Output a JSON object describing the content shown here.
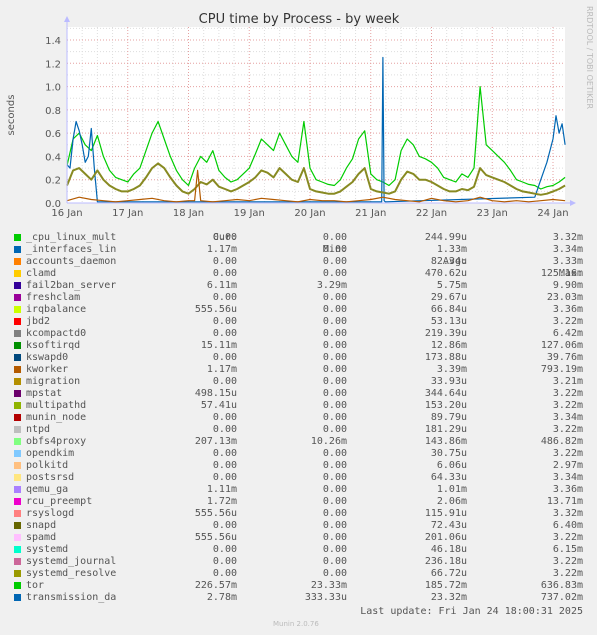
{
  "chart_data": {
    "type": "line",
    "title": "CPU time by Process - by week",
    "xlabel": "",
    "ylabel": "seconds",
    "ylim": [
      0,
      1.5
    ],
    "yticks": [
      "0.0",
      "0.2",
      "0.4",
      "0.6",
      "0.8",
      "1.0",
      "1.2",
      "1.4"
    ],
    "ytick_values": [
      0,
      0.2,
      0.4,
      0.6,
      0.8,
      1.0,
      1.2,
      1.4
    ],
    "xlim_days": [
      0,
      8.2
    ],
    "xticks": [
      "16 Jan",
      "17 Jan",
      "18 Jan",
      "19 Jan",
      "20 Jan",
      "21 Jan",
      "22 Jan",
      "23 Jan",
      "24 Jan"
    ],
    "grid": true,
    "watermark": "RRDTOOL / TOBI OETIKER",
    "series": [
      {
        "name": "tor",
        "color": "#00cc00",
        "x_days": [
          0,
          0.1,
          0.2,
          0.3,
          0.4,
          0.5,
          0.6,
          0.7,
          0.8,
          0.9,
          1.0,
          1.1,
          1.2,
          1.3,
          1.4,
          1.5,
          1.6,
          1.7,
          1.8,
          1.9,
          2.0,
          2.1,
          2.2,
          2.3,
          2.4,
          2.5,
          2.6,
          2.7,
          2.8,
          2.9,
          3.0,
          3.1,
          3.2,
          3.3,
          3.4,
          3.5,
          3.6,
          3.7,
          3.8,
          3.9,
          4.0,
          4.1,
          4.2,
          4.3,
          4.4,
          4.5,
          4.6,
          4.7,
          4.8,
          4.9,
          5.0,
          5.1,
          5.2,
          5.3,
          5.4,
          5.5,
          5.6,
          5.7,
          5.8,
          5.9,
          6.0,
          6.1,
          6.2,
          6.3,
          6.4,
          6.5,
          6.6,
          6.7,
          6.8,
          6.9,
          7.0,
          7.1,
          7.2,
          7.3,
          7.4,
          7.5,
          7.6,
          7.7,
          7.8,
          7.9,
          8.0,
          8.1,
          8.2
        ],
        "values": [
          0.32,
          0.55,
          0.6,
          0.5,
          0.45,
          0.58,
          0.4,
          0.28,
          0.22,
          0.2,
          0.18,
          0.25,
          0.3,
          0.45,
          0.6,
          0.7,
          0.55,
          0.4,
          0.28,
          0.2,
          0.15,
          0.3,
          0.4,
          0.35,
          0.45,
          0.28,
          0.22,
          0.18,
          0.2,
          0.25,
          0.3,
          0.42,
          0.55,
          0.5,
          0.45,
          0.6,
          0.5,
          0.4,
          0.35,
          0.7,
          0.3,
          0.2,
          0.18,
          0.16,
          0.15,
          0.2,
          0.3,
          0.38,
          0.55,
          0.62,
          0.25,
          0.2,
          0.18,
          0.15,
          0.2,
          0.45,
          0.55,
          0.5,
          0.4,
          0.38,
          0.35,
          0.3,
          0.22,
          0.2,
          0.18,
          0.25,
          0.22,
          0.3,
          1.0,
          0.5,
          0.45,
          0.4,
          0.35,
          0.28,
          0.2,
          0.18,
          0.16,
          0.15,
          0.12,
          0.14,
          0.15,
          0.18,
          0.22
        ]
      },
      {
        "name": "transmission_da",
        "color": "#0066b3",
        "x_days": [
          0,
          0.05,
          0.1,
          0.15,
          0.2,
          0.25,
          0.3,
          0.35,
          0.4,
          0.45,
          0.5,
          5.18,
          5.2,
          5.22,
          5.24,
          7.7,
          7.8,
          7.9,
          8.0,
          8.05,
          8.1,
          8.15,
          8.2
        ],
        "values": [
          0.33,
          0.3,
          0.55,
          0.7,
          0.62,
          0.5,
          0.35,
          0.4,
          0.64,
          0.3,
          0.01,
          0.01,
          1.25,
          0.02,
          0.01,
          0.05,
          0.2,
          0.35,
          0.55,
          0.75,
          0.6,
          0.68,
          0.5
        ]
      },
      {
        "name": "obfs4proxy",
        "color": "#888a22",
        "x_days": [
          0,
          0.1,
          0.2,
          0.3,
          0.4,
          0.5,
          0.6,
          0.7,
          0.8,
          0.9,
          1.0,
          1.1,
          1.2,
          1.3,
          1.4,
          1.5,
          1.6,
          1.7,
          1.8,
          1.9,
          2.0,
          2.1,
          2.2,
          2.3,
          2.4,
          2.5,
          2.6,
          2.7,
          2.8,
          2.9,
          3.0,
          3.1,
          3.2,
          3.3,
          3.4,
          3.5,
          3.6,
          3.7,
          3.8,
          3.9,
          4.0,
          4.1,
          4.2,
          4.3,
          4.4,
          4.5,
          4.6,
          4.7,
          4.8,
          4.9,
          5.0,
          5.1,
          5.2,
          5.3,
          5.4,
          5.5,
          5.6,
          5.7,
          5.8,
          5.9,
          6.0,
          6.1,
          6.2,
          6.3,
          6.4,
          6.5,
          6.6,
          6.7,
          6.8,
          6.9,
          7.0,
          7.1,
          7.2,
          7.3,
          7.4,
          7.5,
          7.6,
          7.7,
          7.8,
          7.9,
          8.0,
          8.1,
          8.2
        ],
        "values": [
          0.15,
          0.28,
          0.3,
          0.25,
          0.2,
          0.28,
          0.2,
          0.15,
          0.12,
          0.1,
          0.1,
          0.12,
          0.15,
          0.22,
          0.3,
          0.34,
          0.3,
          0.22,
          0.15,
          0.1,
          0.08,
          0.12,
          0.18,
          0.16,
          0.2,
          0.14,
          0.12,
          0.1,
          0.12,
          0.15,
          0.18,
          0.22,
          0.28,
          0.26,
          0.22,
          0.3,
          0.25,
          0.2,
          0.18,
          0.3,
          0.12,
          0.1,
          0.09,
          0.08,
          0.08,
          0.1,
          0.14,
          0.18,
          0.25,
          0.3,
          0.12,
          0.1,
          0.09,
          0.08,
          0.1,
          0.2,
          0.27,
          0.25,
          0.2,
          0.2,
          0.18,
          0.15,
          0.12,
          0.1,
          0.1,
          0.12,
          0.11,
          0.14,
          0.3,
          0.24,
          0.22,
          0.2,
          0.18,
          0.15,
          0.12,
          0.1,
          0.09,
          0.08,
          0.07,
          0.08,
          0.1,
          0.12,
          0.15
        ]
      },
      {
        "name": "kworker",
        "color": "#b35a00",
        "x_days": [
          0,
          0.2,
          0.4,
          0.6,
          0.8,
          1.0,
          1.2,
          1.4,
          1.6,
          1.8,
          2.0,
          2.1,
          2.15,
          2.2,
          2.4,
          2.6,
          2.8,
          3.0,
          3.2,
          3.4,
          3.6,
          3.8,
          4.0,
          4.2,
          4.4,
          4.6,
          4.8,
          5.0,
          5.2,
          5.4,
          5.6,
          5.8,
          6.0,
          6.2,
          6.4,
          6.6,
          6.8,
          7.0,
          7.2,
          7.4,
          7.6,
          7.8,
          8.0,
          8.2
        ],
        "values": [
          0.02,
          0.05,
          0.03,
          0.02,
          0.01,
          0.02,
          0.03,
          0.04,
          0.02,
          0.01,
          0.02,
          0.02,
          0.28,
          0.02,
          0.01,
          0.02,
          0.03,
          0.02,
          0.04,
          0.03,
          0.02,
          0.01,
          0.03,
          0.02,
          0.02,
          0.01,
          0.02,
          0.03,
          0.05,
          0.03,
          0.02,
          0.01,
          0.04,
          0.02,
          0.01,
          0.02,
          0.05,
          0.02,
          0.01,
          0.02,
          0.01,
          0.02,
          0.03,
          0.02
        ]
      }
    ]
  },
  "legend": {
    "headers": {
      "cur": "Cur:",
      "min": "Min:",
      "avg": "Avg:",
      "max": "Max:"
    },
    "rows": [
      {
        "name": "_cpu_linux_mult",
        "color": "#00cc00",
        "cur": "0.00",
        "min": "0.00",
        "avg": "244.99u",
        "max": "3.32m"
      },
      {
        "name": "_interfaces_lin",
        "color": "#0066b3",
        "cur": "1.17m",
        "min": "0.00",
        "avg": "1.33m",
        "max": "3.34m"
      },
      {
        "name": "accounts_daemon",
        "color": "#ff8000",
        "cur": "0.00",
        "min": "0.00",
        "avg": "82.34u",
        "max": "3.33m"
      },
      {
        "name": "clamd",
        "color": "#ffcc00",
        "cur": "0.00",
        "min": "0.00",
        "avg": "470.62u",
        "max": "125.16m"
      },
      {
        "name": "fail2ban_server",
        "color": "#330099",
        "cur": "6.11m",
        "min": "3.29m",
        "avg": "5.75m",
        "max": "9.90m"
      },
      {
        "name": "freshclam",
        "color": "#990099",
        "cur": "0.00",
        "min": "0.00",
        "avg": "29.67u",
        "max": "23.03m"
      },
      {
        "name": "irqbalance",
        "color": "#ccff00",
        "cur": "555.56u",
        "min": "0.00",
        "avg": "66.84u",
        "max": "3.36m"
      },
      {
        "name": "jbd2",
        "color": "#ff0000",
        "cur": "0.00",
        "min": "0.00",
        "avg": "53.13u",
        "max": "3.22m"
      },
      {
        "name": "kcompactd0",
        "color": "#808080",
        "cur": "0.00",
        "min": "0.00",
        "avg": "219.39u",
        "max": "6.42m"
      },
      {
        "name": "ksoftirqd",
        "color": "#008f00",
        "cur": "15.11m",
        "min": "0.00",
        "avg": "12.86m",
        "max": "127.06m"
      },
      {
        "name": "kswapd0",
        "color": "#00487d",
        "cur": "0.00",
        "min": "0.00",
        "avg": "173.88u",
        "max": "39.76m"
      },
      {
        "name": "kworker",
        "color": "#b35a00",
        "cur": "1.17m",
        "min": "0.00",
        "avg": "3.39m",
        "max": "793.19m"
      },
      {
        "name": "migration",
        "color": "#b38f00",
        "cur": "0.00",
        "min": "0.00",
        "avg": "33.93u",
        "max": "3.21m"
      },
      {
        "name": "mpstat",
        "color": "#6b006b",
        "cur": "498.15u",
        "min": "0.00",
        "avg": "344.64u",
        "max": "3.22m"
      },
      {
        "name": "multipathd",
        "color": "#8fb300",
        "cur": "57.41u",
        "min": "0.00",
        "avg": "153.20u",
        "max": "3.22m"
      },
      {
        "name": "munin_node",
        "color": "#b30000",
        "cur": "0.00",
        "min": "0.00",
        "avg": "89.79u",
        "max": "3.34m"
      },
      {
        "name": "ntpd",
        "color": "#bebebe",
        "cur": "0.00",
        "min": "0.00",
        "avg": "181.29u",
        "max": "3.22m"
      },
      {
        "name": "obfs4proxy",
        "color": "#80ff80",
        "cur": "207.13m",
        "min": "10.26m",
        "avg": "143.86m",
        "max": "486.82m"
      },
      {
        "name": "opendkim",
        "color": "#80c9ff",
        "cur": "0.00",
        "min": "0.00",
        "avg": "30.75u",
        "max": "3.22m"
      },
      {
        "name": "polkitd",
        "color": "#ffc080",
        "cur": "0.00",
        "min": "0.00",
        "avg": "6.06u",
        "max": "2.97m"
      },
      {
        "name": "postsrsd",
        "color": "#ffe680",
        "cur": "0.00",
        "min": "0.00",
        "avg": "64.33u",
        "max": "3.34m"
      },
      {
        "name": "qemu_ga",
        "color": "#aa80ff",
        "cur": "1.11m",
        "min": "0.00",
        "avg": "1.01m",
        "max": "3.36m"
      },
      {
        "name": "rcu_preempt",
        "color": "#ee00cc",
        "cur": "1.72m",
        "min": "0.00",
        "avg": "2.06m",
        "max": "13.71m"
      },
      {
        "name": "rsyslogd",
        "color": "#ff8080",
        "cur": "555.56u",
        "min": "0.00",
        "avg": "115.91u",
        "max": "3.32m"
      },
      {
        "name": "snapd",
        "color": "#666600",
        "cur": "0.00",
        "min": "0.00",
        "avg": "72.43u",
        "max": "6.40m"
      },
      {
        "name": "spamd",
        "color": "#ffbfff",
        "cur": "555.56u",
        "min": "0.00",
        "avg": "201.06u",
        "max": "3.22m"
      },
      {
        "name": "systemd",
        "color": "#00ffcc",
        "cur": "0.00",
        "min": "0.00",
        "avg": "46.18u",
        "max": "6.15m"
      },
      {
        "name": "systemd_journal",
        "color": "#cc6699",
        "cur": "0.00",
        "min": "0.00",
        "avg": "236.18u",
        "max": "3.22m"
      },
      {
        "name": "systemd_resolve",
        "color": "#999900",
        "cur": "0.00",
        "min": "0.00",
        "avg": "66.72u",
        "max": "3.22m"
      },
      {
        "name": "tor",
        "color": "#00cc00",
        "cur": "226.57m",
        "min": "23.33m",
        "avg": "185.72m",
        "max": "636.83m"
      },
      {
        "name": "transmission_da",
        "color": "#0066b3",
        "cur": "2.78m",
        "min": "333.33u",
        "avg": "23.32m",
        "max": "737.02m"
      }
    ]
  },
  "footer": {
    "last_update": "Last update: Fri Jan 24 18:00:31 2025",
    "munin_version": "Munin 2.0.76"
  }
}
